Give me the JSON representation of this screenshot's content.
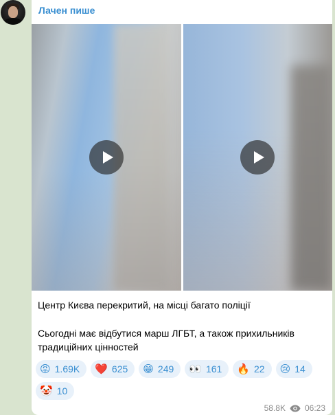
{
  "channel": {
    "name": "Лачен пише"
  },
  "caption": {
    "line1": "Центр Києва перекритий, на місці багато поліції",
    "line2": "Сьогодні має відбутися марш ЛГБТ, а також прихильників традиційних цінностей"
  },
  "reactions": [
    {
      "emoji": "😡",
      "count": "1.69K"
    },
    {
      "emoji": "❤️",
      "count": "625"
    },
    {
      "emoji": "😁",
      "count": "249"
    },
    {
      "emoji": "👀",
      "count": "161"
    },
    {
      "emoji": "🔥",
      "count": "22"
    },
    {
      "emoji": "😢",
      "count": "14"
    },
    {
      "emoji": "🤡",
      "count": "10"
    }
  ],
  "footer": {
    "views": "58.8K",
    "time": "06:23"
  },
  "icons": {
    "views": "eye-icon",
    "play": "play-icon"
  },
  "colors": {
    "accent": "#3a8fd1",
    "background": "#d9e4cf"
  }
}
